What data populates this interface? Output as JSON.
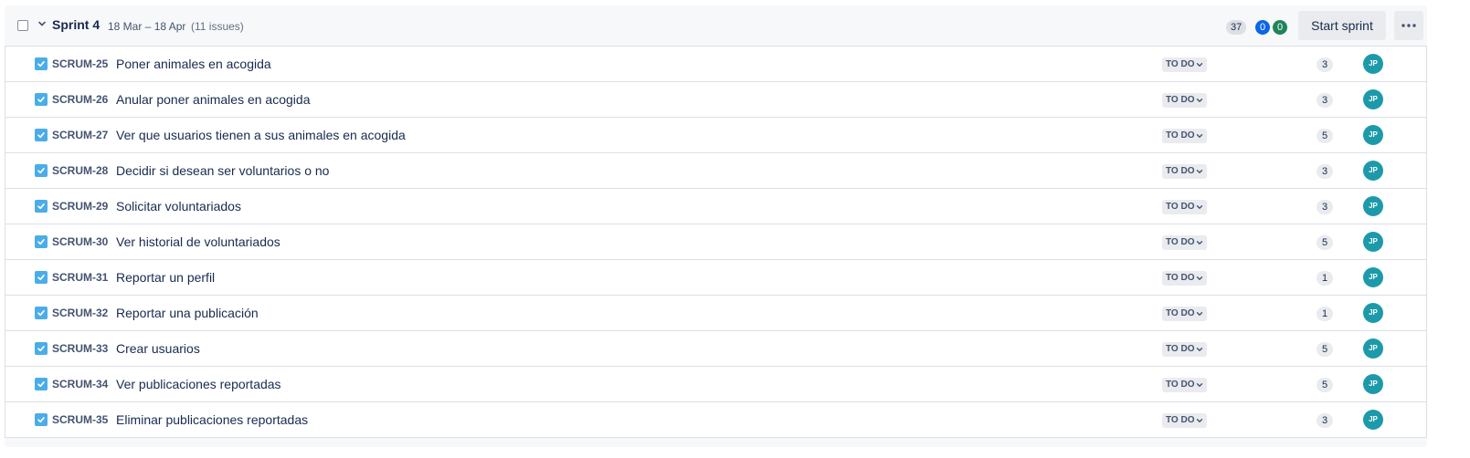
{
  "sprint": {
    "name": "Sprint 4",
    "dates": "18 Mar – 18 Apr",
    "issue_count": "(11 issues)",
    "points_total": "37",
    "points_in_progress": "0",
    "points_done": "0",
    "start_label": "Start sprint",
    "more_icon": "more-horizontal-icon"
  },
  "colors": {
    "story_icon": "#4bade8",
    "in_progress": "#0c66e4",
    "done": "#1f845a",
    "avatar": "#1d9aaa"
  },
  "issues": [
    {
      "key": "SCRUM-25",
      "summary": "Poner animales en acogida",
      "status": "TO DO",
      "estimate": "3",
      "assignee": "JP"
    },
    {
      "key": "SCRUM-26",
      "summary": "Anular poner animales en acogida",
      "status": "TO DO",
      "estimate": "3",
      "assignee": "JP"
    },
    {
      "key": "SCRUM-27",
      "summary": "Ver que usuarios tienen a sus animales en acogida",
      "status": "TO DO",
      "estimate": "5",
      "assignee": "JP"
    },
    {
      "key": "SCRUM-28",
      "summary": "Decidir si desean ser voluntarios o no",
      "status": "TO DO",
      "estimate": "3",
      "assignee": "JP"
    },
    {
      "key": "SCRUM-29",
      "summary": "Solicitar voluntariados",
      "status": "TO DO",
      "estimate": "3",
      "assignee": "JP"
    },
    {
      "key": "SCRUM-30",
      "summary": "Ver historial de voluntariados",
      "status": "TO DO",
      "estimate": "5",
      "assignee": "JP"
    },
    {
      "key": "SCRUM-31",
      "summary": "Reportar un perfil",
      "status": "TO DO",
      "estimate": "1",
      "assignee": "JP"
    },
    {
      "key": "SCRUM-32",
      "summary": "Reportar una publicación",
      "status": "TO DO",
      "estimate": "1",
      "assignee": "JP"
    },
    {
      "key": "SCRUM-33",
      "summary": "Crear usuarios",
      "status": "TO DO",
      "estimate": "5",
      "assignee": "JP"
    },
    {
      "key": "SCRUM-34",
      "summary": "Ver publicaciones reportadas",
      "status": "TO DO",
      "estimate": "5",
      "assignee": "JP"
    },
    {
      "key": "SCRUM-35",
      "summary": "Eliminar publicaciones reportadas",
      "status": "TO DO",
      "estimate": "3",
      "assignee": "JP"
    }
  ]
}
